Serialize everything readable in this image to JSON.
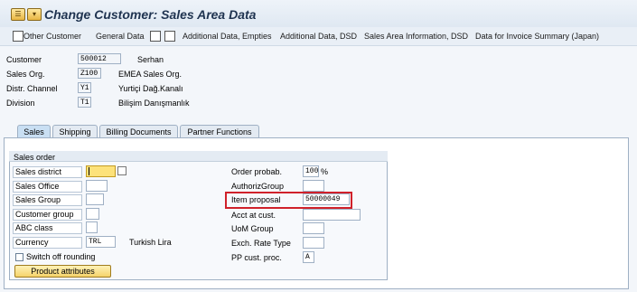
{
  "title": "Change Customer: Sales Area Data",
  "toolbar": {
    "other_customer": "Other Customer",
    "general_data": "General Data",
    "additional_data_empties": "Additional Data, Empties",
    "additional_data_dsd": "Additional Data, DSD",
    "sales_area_info_dsd": "Sales Area Information, DSD",
    "invoice_summary": "Data for Invoice Summary (Japan)"
  },
  "header": {
    "customer_label": "Customer",
    "customer_value": "500012",
    "customer_desc": "Serhan",
    "salesorg_label": "Sales Org.",
    "salesorg_value": "Z100",
    "salesorg_desc": "EMEA Sales Org.",
    "channel_label": "Distr. Channel",
    "channel_value": "Y1",
    "channel_desc": "Yurtiçi Dağ.Kanalı",
    "division_label": "Division",
    "division_value": "T1",
    "division_desc": "Bilişim Danışmanlık"
  },
  "tabs": [
    "Sales",
    "Shipping",
    "Billing Documents",
    "Partner Functions"
  ],
  "group": {
    "title": "Sales order",
    "left": {
      "sales_district": "Sales district",
      "sales_office": "Sales Office",
      "sales_group": "Sales Group",
      "customer_group": "Customer group",
      "abc_class": "ABC class",
      "currency": "Currency",
      "currency_value": "TRL",
      "currency_desc": "Turkish Lira",
      "switch_off_rounding": "Switch off rounding",
      "product_attributes": "Product attributes"
    },
    "right": {
      "order_prob": "Order probab.",
      "order_prob_value": "100",
      "order_prob_unit": "%",
      "authoriz_group": "AuthorizGroup",
      "item_proposal": "Item proposal",
      "item_proposal_value": "50000049",
      "acct_at_cust": "Acct at cust.",
      "uom_group": "UoM Group",
      "exch_rate_type": "Exch. Rate Type",
      "pp_cust_proc": "PP cust. proc.",
      "pp_cust_proc_value": "A"
    }
  },
  "colors": {
    "highlight": "#d0212a",
    "active_tab": "#c9dff3",
    "button": "#f5d36a"
  }
}
